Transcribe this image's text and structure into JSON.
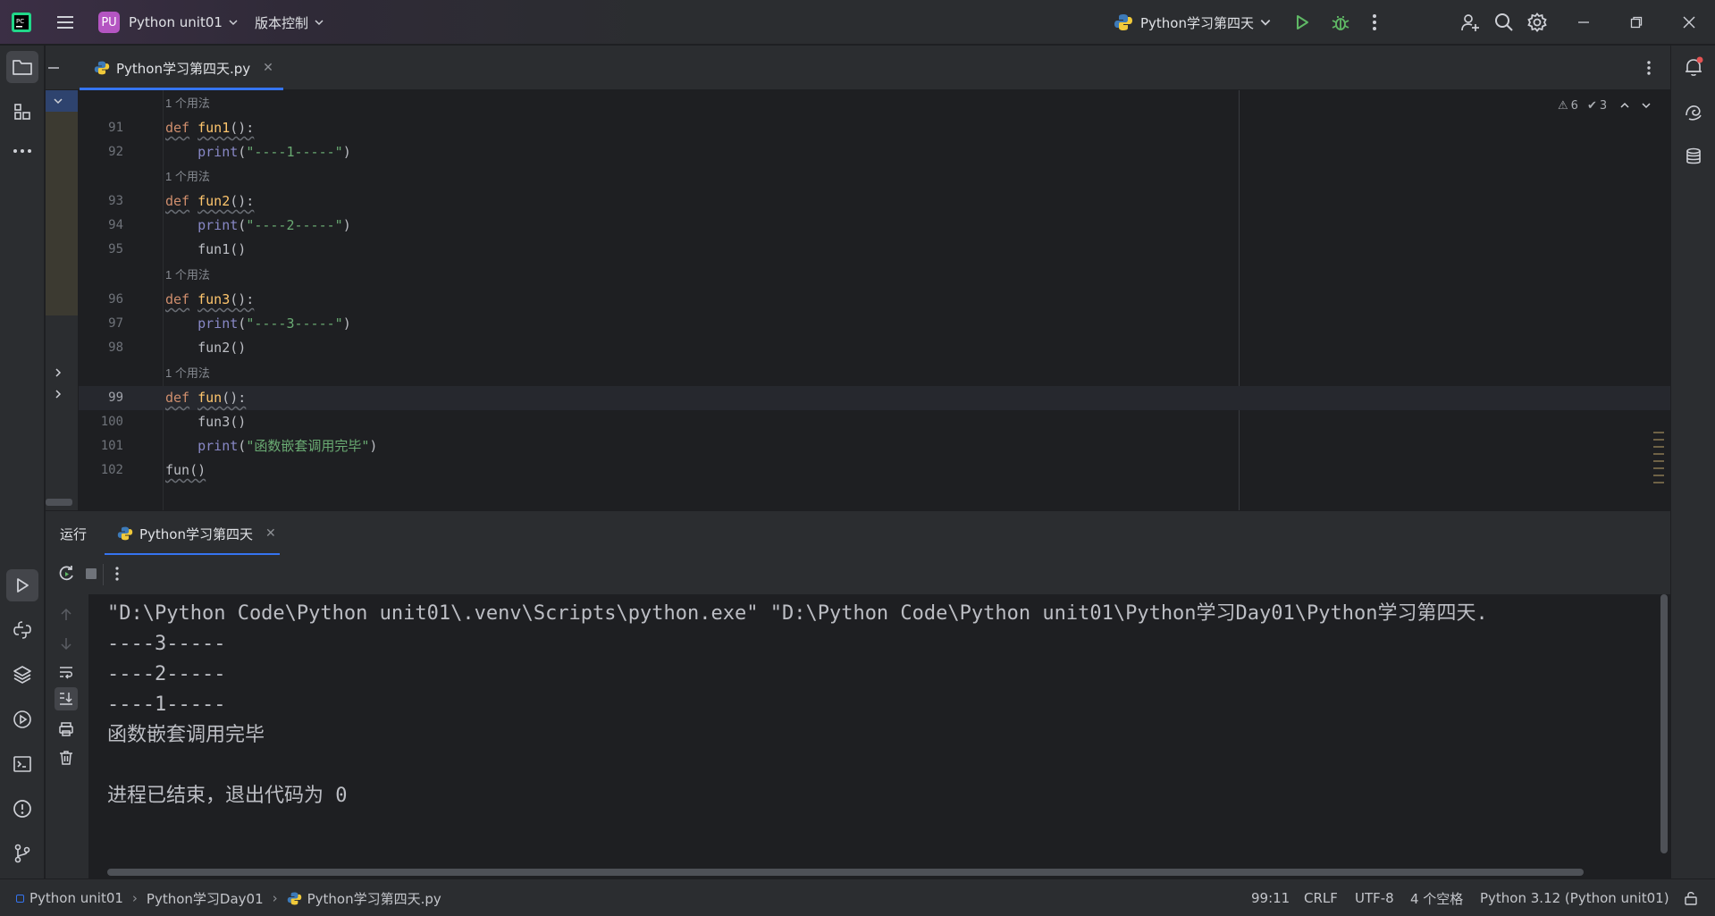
{
  "titlebar": {
    "project_badge": "PU",
    "project_name": "Python unit01",
    "vcs_label": "版本控制",
    "run_config": "Python学习第四天"
  },
  "editor_tab": {
    "label": "Python学习第四天.py"
  },
  "inspections": {
    "warnings": "6",
    "weak_warnings": "3"
  },
  "code": {
    "usage_hint": "1 个用法",
    "lines": [
      {
        "num": "91",
        "text": "def fun1():",
        "hint": true
      },
      {
        "num": "92",
        "text": "    print(\"----1-----\")"
      },
      {
        "num": "93",
        "text": "def fun2():",
        "hint": true
      },
      {
        "num": "94",
        "text": "    print(\"----2-----\")"
      },
      {
        "num": "95",
        "text": "    fun1()"
      },
      {
        "num": "96",
        "text": "def fun3():",
        "hint": true
      },
      {
        "num": "97",
        "text": "    print(\"----3-----\")"
      },
      {
        "num": "98",
        "text": "    fun2()"
      },
      {
        "num": "99",
        "text": "def fun():",
        "hint": true
      },
      {
        "num": "100",
        "text": "    fun3()"
      },
      {
        "num": "101",
        "text": "    print(\"函数嵌套调用完毕\")"
      },
      {
        "num": "102",
        "text": "fun()"
      }
    ]
  },
  "run_panel": {
    "title": "运行",
    "tab_label": "Python学习第四天",
    "output": [
      "\"D:\\Python Code\\Python unit01\\.venv\\Scripts\\python.exe\" \"D:\\Python Code\\Python unit01\\Python学习Day01\\Python学习第四天.",
      "----3-----",
      "----2-----",
      "----1-----",
      "函数嵌套调用完毕",
      "",
      "进程已结束，退出代码为 0"
    ]
  },
  "statusbar": {
    "crumb_project": "Python unit01",
    "crumb_folder": "Python学习Day01",
    "crumb_file": "Python学习第四天.py",
    "position": "99:11",
    "line_sep": "CRLF",
    "encoding": "UTF-8",
    "indent": "4 个空格",
    "interpreter": "Python 3.12 (Python unit01)"
  },
  "colors": {
    "accent": "#3574f0",
    "run_green": "#5fb865",
    "badge": "#b455c2"
  }
}
